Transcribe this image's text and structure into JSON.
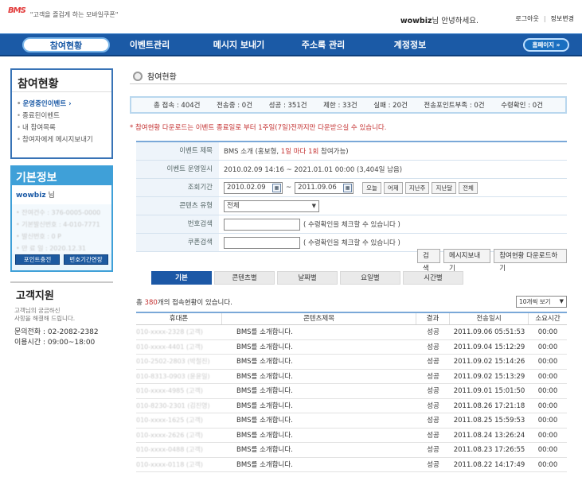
{
  "header": {
    "logo": "BMS",
    "logo_sup": "",
    "slogan": "\"고객을 즐겁게 하는 모바일쿠폰\"",
    "greeting_user": "wowbiz",
    "greeting_text": "님 안녕하세요.",
    "logout": "로그아웃",
    "separator": "|",
    "edit_info": "정보변경"
  },
  "nav": {
    "items": [
      "참여현황",
      "이벤트관리",
      "메시지 보내기",
      "주소록 관리",
      "계정정보"
    ],
    "home": "홈페이지  »"
  },
  "sidebar": {
    "section_title": "참여현황",
    "items": [
      {
        "label": "운영중인이벤트 ›",
        "active": true
      },
      {
        "label": "종료된이벤트",
        "active": false
      },
      {
        "label": "내 참여목록",
        "active": false
      },
      {
        "label": "참여자에게 메시지보내기",
        "active": false
      }
    ],
    "basic_info_title": "기본정보",
    "user": "wowbiz",
    "user_suffix": "님",
    "info_rows": [
      "• 잔여건수 : 376-0005-0000",
      "• 기본발신번호 : 4-010-7771",
      "• 발신번호 : 0 P",
      "• 만 료 일 : 2020.12.31"
    ],
    "btn_point": "포인트충전",
    "btn_extend": "번호기간연장",
    "support_title": "고객지원",
    "support_desc_1": "고객님의 궁금하신",
    "support_desc_2": "사항을 해결해 드립니다.",
    "phone": "문의전화 : 02-2082-2382",
    "hours": "이용시간 : 09:00~18:00"
  },
  "main": {
    "page_title": "참여현황",
    "summary": [
      "총 접속 : 404건",
      "전송중 : 0건",
      "성공 : 351건",
      "제한 : 33건",
      "실패 : 20건",
      "전송포인트부족 : 0건",
      "수령확인 : 0건"
    ],
    "notice": "* 참여현황 다운로드는 이벤트 종료일로 부터 1주일(7일)전까지만 다운받으실 수 있습니다.",
    "form": {
      "event_title_label": "이벤트 제목",
      "event_title_value": "BMS 소개 (홍보형,",
      "event_title_red": "1일 마다 1회",
      "event_title_tail": "참여가능)",
      "period_label": "이벤트 운영일시",
      "period_value": "2010.02.09 14:16 ~ 2021.01.01 00:00 (3,404일 남음)",
      "search_period_label": "조회기간",
      "date_from": "2010.02.09",
      "date_to": "2011.09.06",
      "tilde": "~",
      "quick": [
        "오늘",
        "어제",
        "지난주",
        "지난달",
        "전체"
      ],
      "content_type_label": "콘텐츠 유형",
      "content_type_value": "전체",
      "phone_search_label": "번호검색",
      "phone_hint": "( 수령확인을 체크할 수 있습니다 )",
      "coupon_search_label": "쿠폰검색",
      "coupon_hint": "( 수령확인을 체크할 수 있습니다 )"
    },
    "actions": [
      "검색",
      "메시지보내기",
      "참여현황 다운로드하기"
    ],
    "tabs": [
      "기본",
      "콘텐츠별",
      "날짜별",
      "요일별",
      "시간별"
    ],
    "count_prefix": "총",
    "count_num": "380",
    "count_suffix": "개의 접속현황이 있습니다.",
    "per_page": "10개씩 보기",
    "table": {
      "headers": [
        "휴대폰",
        "콘텐츠제목",
        "결과",
        "전송일시",
        "소요시간"
      ],
      "rows": [
        [
          "010-xxxx-2328 (고객)",
          "BMS를 소개합니다.",
          "성공",
          "2011.09.06 05:51:53",
          "00:00"
        ],
        [
          "010-xxxx-4401 (고객)",
          "BMS를 소개합니다.",
          "성공",
          "2011.09.04 15:12:29",
          "00:00"
        ],
        [
          "010-2502-2803 (박철진)",
          "BMS를 소개합니다.",
          "성공",
          "2011.09.02 15:14:26",
          "00:00"
        ],
        [
          "010-8313-0903 (윤윤일)",
          "BMS를 소개합니다.",
          "성공",
          "2011.09.02 15:13:29",
          "00:00"
        ],
        [
          "010-xxxx-4985 (고객)",
          "BMS를 소개합니다.",
          "성공",
          "2011.09.01 15:01:50",
          "00:00"
        ],
        [
          "010-8230-2301 (김진영)",
          "BMS를 소개합니다.",
          "성공",
          "2011.08.26 17:21:18",
          "00:00"
        ],
        [
          "010-xxxx-1625 (고객)",
          "BMS를 소개합니다.",
          "성공",
          "2011.08.25 15:59:53",
          "00:00"
        ],
        [
          "010-xxxx-2626 (고객)",
          "BMS를 소개합니다.",
          "성공",
          "2011.08.24 13:26:24",
          "00:00"
        ],
        [
          "010-xxxx-0488 (고객)",
          "BMS를 소개합니다.",
          "성공",
          "2011.08.23 17:26:55",
          "00:00"
        ],
        [
          "010-xxxx-0118 (고객)",
          "BMS를 소개합니다.",
          "성공",
          "2011.08.22 14:17:49",
          "00:00"
        ]
      ]
    }
  },
  "colors": {
    "nav_bg": "#1b5aa6",
    "accent_red": "#c43131",
    "tab_active": "#1c58a6"
  }
}
